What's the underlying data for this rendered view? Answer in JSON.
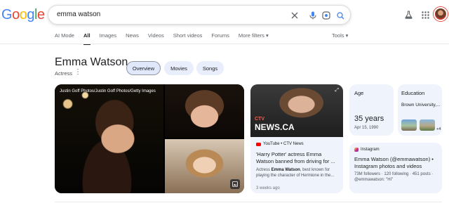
{
  "logo": [
    "G",
    "o",
    "o",
    "g",
    "l",
    "e"
  ],
  "search": {
    "query": "emma watson"
  },
  "tabs": [
    {
      "label": "AI Mode",
      "active": false
    },
    {
      "label": "All",
      "active": true
    },
    {
      "label": "Images",
      "active": false
    },
    {
      "label": "News",
      "active": false
    },
    {
      "label": "Videos",
      "active": false
    },
    {
      "label": "Short videos",
      "active": false
    },
    {
      "label": "Forums",
      "active": false
    },
    {
      "label": "More filters ▾",
      "active": false
    }
  ],
  "tools_label": "Tools ▾",
  "entity": {
    "name": "Emma Watson",
    "subtitle": "Actress"
  },
  "chips": [
    {
      "label": "Overview",
      "active": true
    },
    {
      "label": "Movies",
      "active": false
    },
    {
      "label": "Songs",
      "active": false
    }
  ],
  "images": {
    "credit": "Justin Goff Photos/Justin Goff Photos/Getty Images"
  },
  "news": {
    "logo_top": "CTV",
    "logo_main": "NEWS.CA",
    "source": "YouTube • CTV News",
    "headline": "'Harry Potter' actress Emma Watson banned from driving for ...",
    "snippet_prefix": "Actress ",
    "snippet_bold": "Emma Watson",
    "snippet_rest": ", best known for playing the character of Hermione in the...",
    "age": "3 weeks ago"
  },
  "age_card": {
    "label": "Age",
    "value": "35 years",
    "date": "Apr 15, 1990"
  },
  "education_card": {
    "label": "Education",
    "value": "Brown University,...",
    "more": "+4"
  },
  "instagram_card": {
    "source": "Instagram",
    "title": "Emma Watson (@emmawatson) • Instagram photos and videos",
    "stats": "73M followers · 120 following · 451 posts · @emmawatson: \"Hi\""
  },
  "colors": {
    "blue": "#4285f4",
    "red": "#ea4335",
    "yellow": "#fbbc05",
    "green": "#34a853",
    "card_bg": "#eef3fc"
  }
}
